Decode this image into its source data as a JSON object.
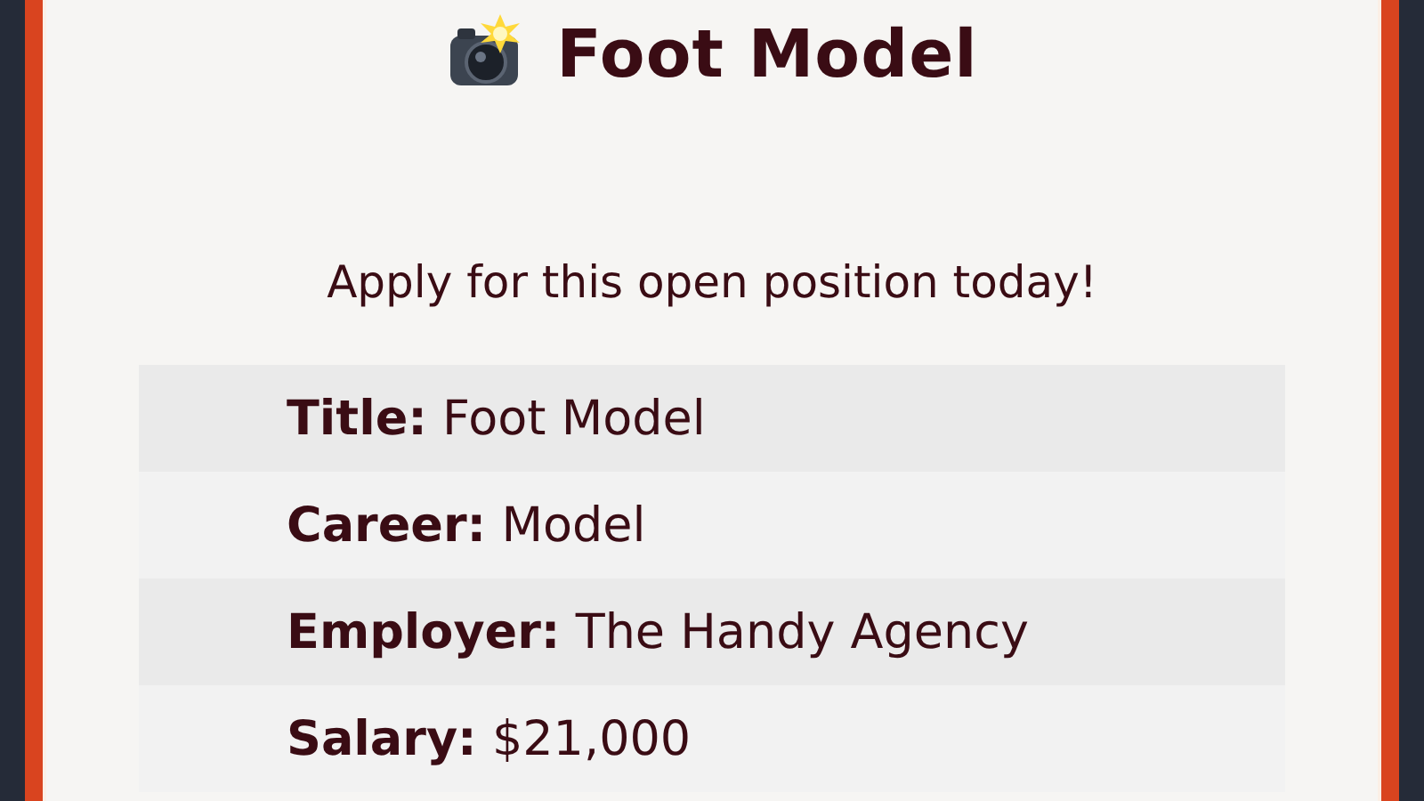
{
  "dialog": {
    "title": "Foot Model",
    "subtitle": "Apply for this open position today!",
    "details": [
      {
        "label": "Title:",
        "value": "Foot Model"
      },
      {
        "label": "Career:",
        "value": "Model"
      },
      {
        "label": "Employer:",
        "value": "The Handy Agency"
      },
      {
        "label": "Salary:",
        "value": "$21,000"
      }
    ]
  }
}
